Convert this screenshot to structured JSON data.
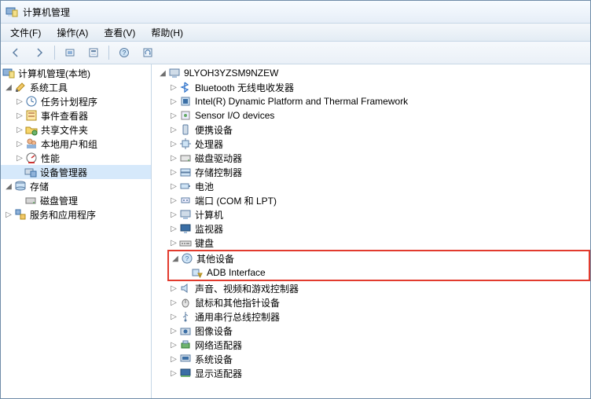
{
  "window": {
    "title": "计算机管理"
  },
  "menu": {
    "file": "文件(F)",
    "action": "操作(A)",
    "view": "查看(V)",
    "help": "帮助(H)"
  },
  "leftTree": {
    "root": "计算机管理(本地)",
    "systools": {
      "label": "系统工具",
      "children": {
        "task": "任务计划程序",
        "event": "事件查看器",
        "shared": "共享文件夹",
        "users": "本地用户和组",
        "perf": "性能",
        "devmgr": "设备管理器"
      }
    },
    "storage": {
      "label": "存储",
      "disk": "磁盘管理"
    },
    "services": "服务和应用程序"
  },
  "rightTree": {
    "computer": "9LYOH3YZSM9NZEW",
    "items": {
      "bluetooth": "Bluetooth 无线电收发器",
      "intel": "Intel(R) Dynamic Platform and Thermal Framework",
      "sensor": "Sensor I/O devices",
      "portable": "便携设备",
      "cpu": "处理器",
      "diskdrive": "磁盘驱动器",
      "storagectl": "存储控制器",
      "battery": "电池",
      "ports": "端口 (COM 和 LPT)",
      "computers": "计算机",
      "monitor": "监视器",
      "keyboard": "键盘",
      "other": "其他设备",
      "adb": "ADB Interface",
      "sound": "声音、视频和游戏控制器",
      "mouse": "鼠标和其他指针设备",
      "usb": "通用串行总线控制器",
      "imaging": "图像设备",
      "network": "网络适配器",
      "sysdev": "系统设备",
      "display": "显示适配器"
    }
  }
}
